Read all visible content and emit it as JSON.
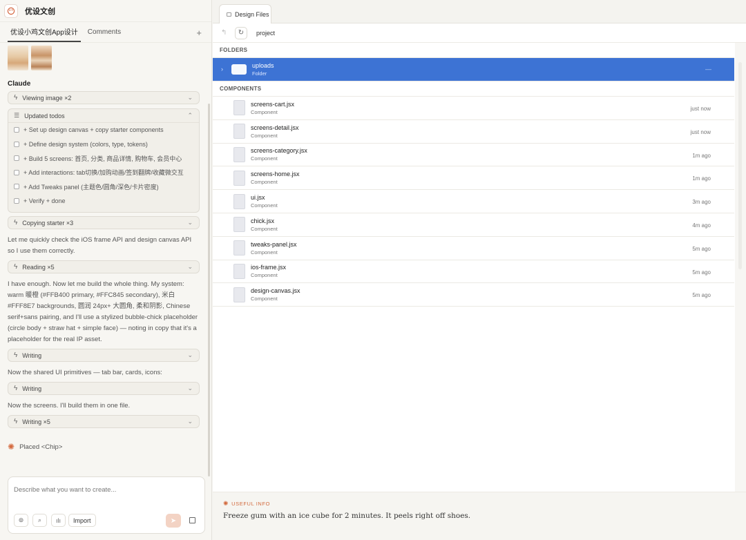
{
  "app": {
    "title": "优设文创",
    "logo_icon": "palette-icon"
  },
  "left_tabs": {
    "active": "优设小鸡文创App设计",
    "comments": "Comments",
    "add": "+"
  },
  "chat": {
    "sender": "Claude",
    "tool1": {
      "label": "Viewing image ×2"
    },
    "todos": {
      "title": "Updated todos",
      "items": [
        "+ Set up design canvas + copy starter components",
        "+ Define design system (colors, type, tokens)",
        "+ Build 5 screens: 首页, 分类, 商品详情, 购物车, 会员中心",
        "+ Add interactions: tab切换/加购动画/签到翻牌/收藏微交互",
        "+ Add Tweaks panel (主题色/圆角/深色/卡片密度)",
        "+ Verify + done"
      ]
    },
    "tool2": {
      "label": "Copying starter ×3"
    },
    "para1": "Let me quickly check the iOS frame API and design canvas API so I use them correctly.",
    "tool3": {
      "label": "Reading ×5"
    },
    "para2": "I have enough. Now let me build the whole thing. My system: warm 暖橙 (#FFB400 primary, #FFC845 secondary), 米白 #FFF8E7 backgrounds, 圆润 24px+ 大圆角, 柔和阴影, Chinese serif+sans pairing, and I'll use a stylized bubble-chick placeholder (circle body + straw hat + simple face) — noting in copy that it's a placeholder for the real IP asset.",
    "tool4": {
      "label": "Writing"
    },
    "para3": "Now the shared UI primitives — tab bar, cards, icons:",
    "tool5": {
      "label": "Writing"
    },
    "para4": "Now the screens. I'll build them in one file.",
    "tool6": {
      "label": "Writing ×5"
    },
    "placed": "Placed <Chip>"
  },
  "composer": {
    "placeholder": "Describe what you want to create...",
    "import_label": "Import"
  },
  "files_tab": {
    "label": "Design Files"
  },
  "toolbar": {
    "path": "project"
  },
  "sections": {
    "folders": "FOLDERS",
    "components": "COMPONENTS"
  },
  "folder": {
    "name": "uploads",
    "kind": "Folder",
    "dash": "—"
  },
  "files": [
    {
      "name": "screens-cart.jsx",
      "kind": "Component",
      "time": "just now"
    },
    {
      "name": "screens-detail.jsx",
      "kind": "Component",
      "time": "just now"
    },
    {
      "name": "screens-category.jsx",
      "kind": "Component",
      "time": "1m ago"
    },
    {
      "name": "screens-home.jsx",
      "kind": "Component",
      "time": "1m ago"
    },
    {
      "name": "ui.jsx",
      "kind": "Component",
      "time": "3m ago"
    },
    {
      "name": "chick.jsx",
      "kind": "Component",
      "time": "4m ago"
    },
    {
      "name": "tweaks-panel.jsx",
      "kind": "Component",
      "time": "5m ago"
    },
    {
      "name": "ios-frame.jsx",
      "kind": "Component",
      "time": "5m ago"
    },
    {
      "name": "design-canvas.jsx",
      "kind": "Component",
      "time": "5m ago"
    }
  ],
  "info": {
    "label": "USEFUL INFO",
    "text": "Freeze gum with an ice cube for 2 minutes. It peels right off shoes."
  },
  "colors": {
    "accent": "#3d73d4",
    "brand": "#d46a3f"
  }
}
